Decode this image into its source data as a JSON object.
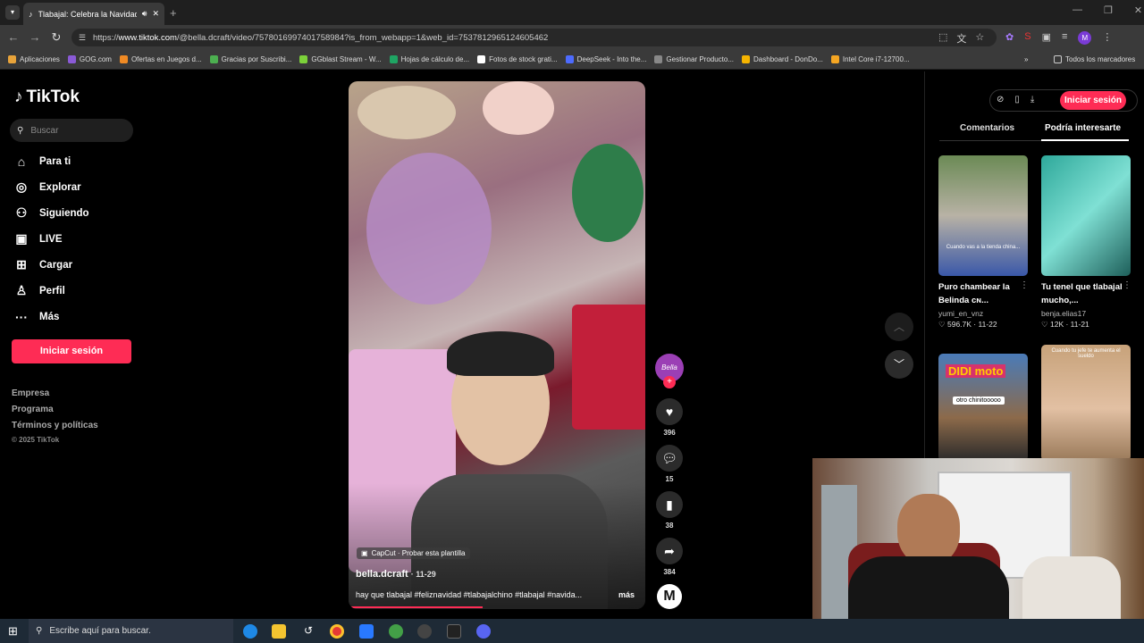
{
  "browser": {
    "tab_title": "Tlabajal: Celebra la Navidad",
    "url_prefix": "https://",
    "url_host": "www.tiktok.com",
    "url_path": "/@bella.dcraft/video/7578016997401758984?is_from_webapp=1&web_id=7537812965124605462",
    "bookmarks": [
      {
        "label": "Aplicaciones",
        "color": "#e8a33a"
      },
      {
        "label": "GOG.com",
        "color": "#8a5ad6"
      },
      {
        "label": "Ofertas en Juegos d...",
        "color": "#f08a24"
      },
      {
        "label": "Gracias por Suscribi...",
        "color": "#4caf50"
      },
      {
        "label": "GGblast Stream - W...",
        "color": "#7cd13a"
      },
      {
        "label": "Hojas de cálculo de...",
        "color": "#1fa463"
      },
      {
        "label": "Fotos de stock grati...",
        "color": "#ffffff"
      },
      {
        "label": "DeepSeek - Into the...",
        "color": "#4d6bfe"
      },
      {
        "label": "Gestionar Producto...",
        "color": "#888888"
      },
      {
        "label": "Dashboard - DonDo...",
        "color": "#f5b400"
      },
      {
        "label": "Intel Core i7-12700...",
        "color": "#f5a623"
      }
    ],
    "bookmarks_all": "Todos los marcadores",
    "profile_letter": "M"
  },
  "tiktok": {
    "logo": "TikTok",
    "search_placeholder": "Buscar",
    "nav": [
      {
        "label": "Para ti",
        "icon": "home-icon"
      },
      {
        "label": "Explorar",
        "icon": "compass-icon"
      },
      {
        "label": "Siguiendo",
        "icon": "following-icon"
      },
      {
        "label": "LIVE",
        "icon": "live-icon"
      },
      {
        "label": "Cargar",
        "icon": "upload-icon"
      },
      {
        "label": "Perfil",
        "icon": "profile-icon"
      },
      {
        "label": "Más",
        "icon": "more-icon"
      }
    ],
    "login_button": "Iniciar sesión",
    "footer": [
      "Empresa",
      "Programa",
      "Términos y políticas"
    ],
    "copyright": "© 2025 TikTok",
    "video": {
      "capcut": "CapCut · Probar esta plantilla",
      "author": "bella.dcraft",
      "date": "· 11-29",
      "caption": "hay que tlabajal #feliznavidad #tlabajalchino #tlabajal #navida...",
      "more": "más",
      "avatar_text": "Bella"
    },
    "actions": {
      "likes": "396",
      "comments": "15",
      "saves": "38",
      "shares": "384"
    },
    "right": {
      "login_button": "Iniciar sesión",
      "tab_comments": "Comentarios",
      "tab_suggested": "Podría interesarte",
      "videos": [
        {
          "title": "Puro chambear la Belinda ᴄɴ...",
          "user": "yumi_en_vnz",
          "likes": "596.7K",
          "date": "11-22",
          "overlay": "Cuando vas a la tienda china..."
        },
        {
          "title": "Tu tenel que tlabajal mucho,...",
          "user": "benja.elias17",
          "likes": "12K",
          "date": "11-21",
          "overlay": ""
        },
        {
          "title": "",
          "user": "",
          "likes": "",
          "date": "",
          "overlay": "DIDI moto",
          "sub": "otro chinitooooo"
        },
        {
          "title": "",
          "user": "",
          "likes": "",
          "date": "",
          "overlay": "Cuando tu jefe te aumenta el sueldo"
        }
      ]
    }
  },
  "taskbar": {
    "search_placeholder": "Escribe aquí para buscar."
  }
}
